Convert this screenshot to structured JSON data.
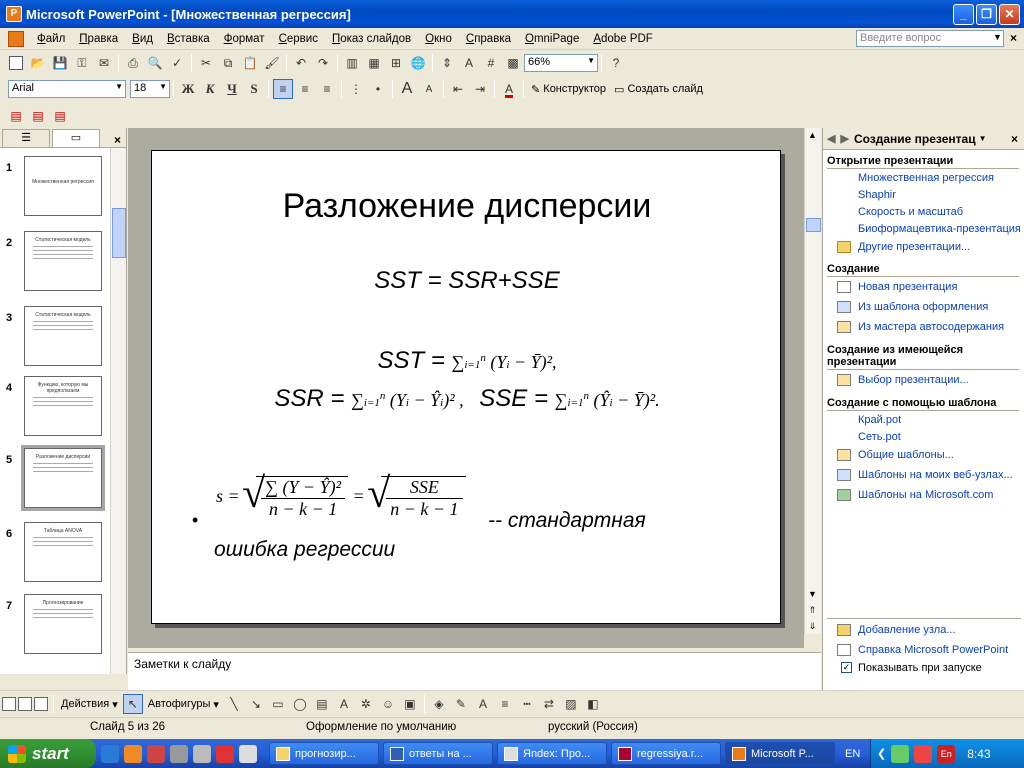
{
  "window": {
    "title": "Microsoft PowerPoint - [Множественная регрессия]",
    "app_icon": "powerpoint-icon"
  },
  "menubar": {
    "items": [
      "Файл",
      "Правка",
      "Вид",
      "Вставка",
      "Формат",
      "Сервис",
      "Показ слайдов",
      "Окно",
      "Справка",
      "OmniPage",
      "Adobe PDF"
    ],
    "help_placeholder": "Введите вопрос"
  },
  "toolbar": {
    "zoom": "66%",
    "font": "Arial",
    "font_size": "18",
    "bold": "Ж",
    "italic": "К",
    "underline": "Ч",
    "shadow": "S",
    "designer_label": "Конструктор",
    "new_slide_label": "Создать слайд"
  },
  "thumbnails": {
    "numbers": [
      "1",
      "2",
      "3",
      "4",
      "5",
      "6",
      "7"
    ],
    "titles": [
      "Множественная регрессия",
      "Статистическая модель",
      "Статистическая модель",
      "Функцию, которую мы предполагаем",
      "Разложение дисперсии",
      "Таблица ANOVA",
      "Прогнозирование"
    ],
    "selected_index": 5
  },
  "slide": {
    "title": "Разложение дисперсии",
    "eq1": "SST = SSR+SSE",
    "eq2_lhs": "SST = ",
    "eq3_ssr": "SSR = ",
    "eq3_sse": "SSE = ",
    "bullet_text1": "-- стандартная",
    "bullet_text2": "ошибка регрессии",
    "formula_s": "s =",
    "sum_num": "∑ (Y − Ŷ)²",
    "den": "n − k − 1",
    "sse": "SSE"
  },
  "notes": {
    "placeholder": "Заметки к слайду"
  },
  "taskpane": {
    "title": "Создание презентац",
    "sections": [
      {
        "label": "Открытие презентации"
      },
      {
        "label": "Создание"
      },
      {
        "label": "Создание из имеющейся презентации"
      },
      {
        "label": "Создание с помощью шаблона"
      }
    ],
    "recent": [
      "Множественная регрессия",
      "Shaphir",
      "Скорость и масштаб",
      "Биоформацевтика-презентация"
    ],
    "other_presentations": "Другие презентации...",
    "create": [
      "Новая презентация",
      "Из шаблона оформления",
      "Из мастера автосодержания"
    ],
    "from_existing": "Выбор презентации...",
    "templates": [
      "Край.pot",
      "Сеть.pot",
      "Общие шаблоны...",
      "Шаблоны на моих веб-узлах...",
      "Шаблоны на Microsoft.com"
    ],
    "bottom": [
      "Добавление узла...",
      "Справка Microsoft PowerPoint"
    ],
    "show_at_startup": "Показывать при запуске"
  },
  "drawbar": {
    "actions": "Действия",
    "autoshapes": "Автофигуры"
  },
  "statusbar": {
    "slide_counter": "Слайд 5 из 26",
    "design": "Оформление по умолчанию",
    "language": "русский (Россия)"
  },
  "taskbar": {
    "start": "start",
    "tasks": [
      "прогнозир...",
      "ответы на ...",
      "Яndex: Про...",
      "regressiya.r...",
      "Microsoft P..."
    ],
    "lang": "EN",
    "kbd": "En",
    "clock": "8:43"
  }
}
